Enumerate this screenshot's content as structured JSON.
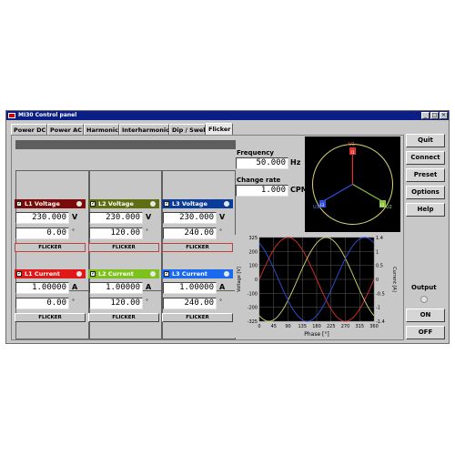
{
  "window": {
    "title": "MI30 Control panel"
  },
  "tabs": [
    "Power DC",
    "Power AC",
    "Harmonic",
    "Interharmonic",
    "Dip / Swell",
    "Flicker"
  ],
  "active_tab": "Flicker",
  "voltage": [
    {
      "label": "L1 Voltage",
      "magnitude": "230.000",
      "angle": "0.00",
      "color": "#7c0a0a"
    },
    {
      "label": "L2 Voltage",
      "magnitude": "230.000",
      "angle": "120.00",
      "color": "#5f6e10"
    },
    {
      "label": "L3 Voltage",
      "magnitude": "230.000",
      "angle": "240.00",
      "color": "#0a3c9c"
    }
  ],
  "current": [
    {
      "label": "L1 Current",
      "magnitude": "1.00000",
      "angle": "0.00",
      "color": "#e01818"
    },
    {
      "label": "L2 Current",
      "magnitude": "1.00000",
      "angle": "120.00",
      "color": "#7cc21a"
    },
    {
      "label": "L3 Current",
      "magnitude": "1.00000",
      "angle": "240.00",
      "color": "#1a6aef"
    }
  ],
  "units": {
    "voltage": "V",
    "current": "A",
    "angle": "°"
  },
  "flicker_button": "FLICKER",
  "frequency": {
    "label": "Frequency",
    "value": "50.000",
    "unit": "Hz"
  },
  "change_rate": {
    "label": "Change rate",
    "value": "1.000",
    "unit": "CPM"
  },
  "phasor": {
    "labels": [
      "U1",
      "I1",
      "U2",
      "I2",
      "U3",
      "I3"
    ]
  },
  "chart": {
    "xlabel": "Phase [°]",
    "ylabel_left": "Voltage [V]",
    "ylabel_right": "Current [A]",
    "x_ticks": [
      "0",
      "45",
      "90",
      "135",
      "180",
      "225",
      "270",
      "315",
      "360"
    ],
    "y_left_ticks": [
      "325",
      "200",
      "100",
      "0",
      "-100",
      "-200",
      "-325"
    ],
    "y_right_ticks": [
      "1.4",
      "1",
      "0.5",
      "0",
      "-0.5",
      "-1",
      "-1.4"
    ]
  },
  "chart_data": {
    "type": "line",
    "xlim": [
      0,
      360
    ],
    "ylim": [
      -325,
      325
    ],
    "y2lim": [
      -1.4,
      1.4
    ],
    "series": [
      {
        "phase_deg": 0,
        "amplitude_v": 325.27,
        "amplitude_a": 1.414,
        "color": "#e03030"
      },
      {
        "phase_deg": 120,
        "amplitude_v": 325.27,
        "amplitude_a": 1.414,
        "color": "#d8d870"
      },
      {
        "phase_deg": 240,
        "amplitude_v": 325.27,
        "amplitude_a": 1.414,
        "color": "#3050e0"
      }
    ]
  },
  "side_buttons": [
    "Quit",
    "Connect",
    "Preset",
    "Options",
    "Help"
  ],
  "output": {
    "label": "Output",
    "on": "ON",
    "off": "OFF"
  }
}
